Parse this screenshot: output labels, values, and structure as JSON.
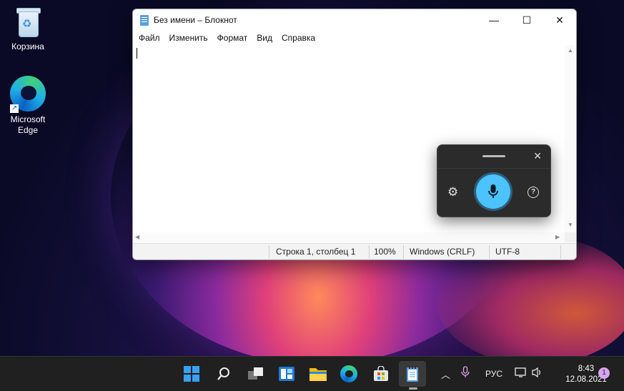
{
  "desktop": {
    "icons": [
      {
        "label": "Корзина"
      },
      {
        "label": "Microsoft Edge"
      }
    ]
  },
  "notepad": {
    "title": "Без имени – Блокнот",
    "menu": [
      "Файл",
      "Изменить",
      "Формат",
      "Вид",
      "Справка"
    ],
    "status": {
      "position": "Строка 1, столбец 1",
      "zoom": "100%",
      "line_endings": "Windows (CRLF)",
      "encoding": "UTF-8"
    },
    "controls": {
      "minimize": "—",
      "maximize": "☐",
      "close": "✕"
    }
  },
  "voice_typing": {
    "close_glyph": "✕",
    "help_glyph": "?",
    "mic_color": "#4cc2ff"
  },
  "taskbar": {
    "language": "РУС",
    "time": "8:43",
    "date": "12.08.2021",
    "notifications": "1",
    "accent": "#0078d4"
  }
}
